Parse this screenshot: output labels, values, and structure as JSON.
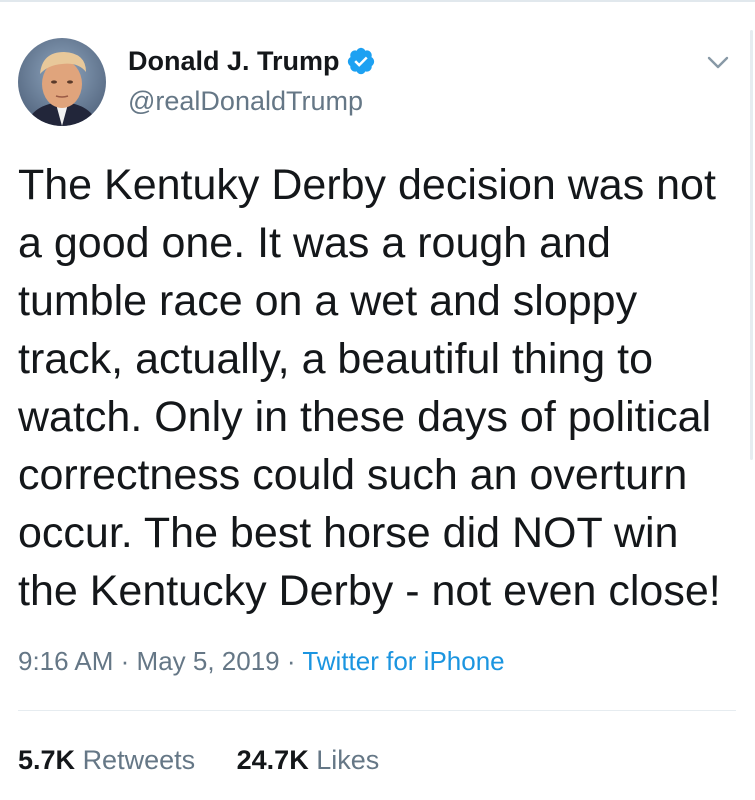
{
  "tweet": {
    "author": {
      "display_name": "Donald J. Trump",
      "handle": "@realDonaldTrump",
      "verified": true
    },
    "text_lines": [
      "The Kentuky Derby decision was not",
      "a good one. It was a rough and",
      "tumble race on a wet and sloppy",
      "track, actually, a beautiful thing to",
      "watch. Only in these days of political",
      "correctness could such an overturn",
      "occur. The best horse did NOT win",
      "the Kentucky Derby - not even close!"
    ],
    "time": "9:16 AM",
    "separator": "·",
    "date": "May 5, 2019",
    "source": "Twitter for iPhone",
    "retweets": {
      "count": "5.7K",
      "label": "Retweets"
    },
    "likes": {
      "count": "24.7K",
      "label": "Likes"
    }
  },
  "icons": {
    "verified": "verified-badge-icon",
    "menu": "chevron-down-icon"
  },
  "colors": {
    "text": "#14171a",
    "secondary": "#657786",
    "link": "#1b95e0",
    "verified": "#1da1f2"
  }
}
